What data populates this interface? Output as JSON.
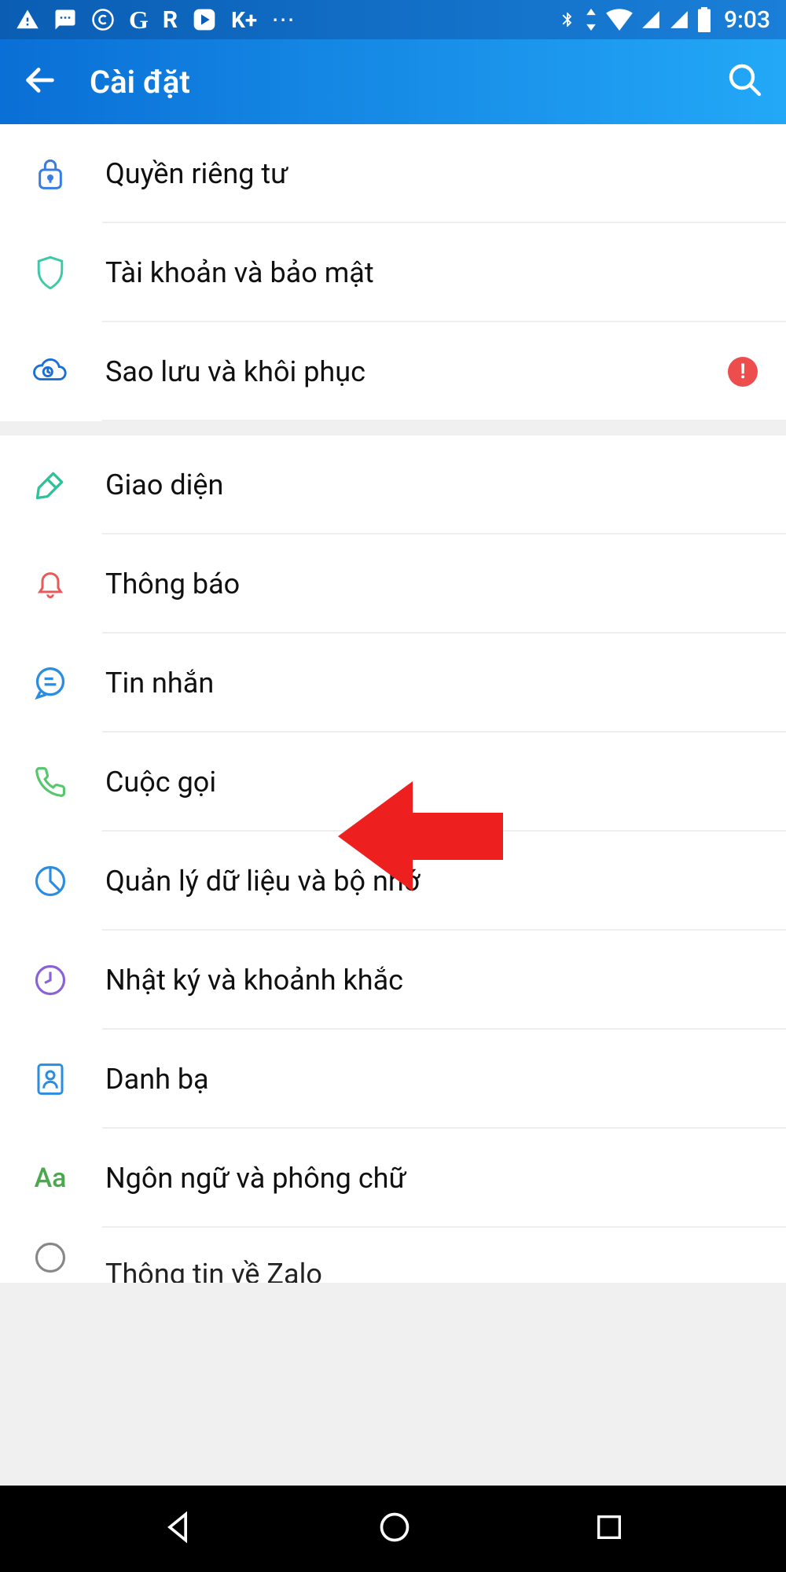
{
  "status": {
    "time": "9:03",
    "apps": [
      "⚠",
      "chat",
      "©",
      "G",
      "R",
      "▶",
      "K+",
      "⋯"
    ],
    "indicators": [
      "bluetooth",
      "wifi",
      "signal",
      "signal",
      "battery"
    ]
  },
  "header": {
    "title": "Cài đặt"
  },
  "sections": [
    {
      "items": [
        {
          "icon": "lock",
          "label": "Quyền riêng tư",
          "alert": false
        },
        {
          "icon": "shield",
          "label": "Tài khoản và bảo mật",
          "alert": false
        },
        {
          "icon": "cloud-backup",
          "label": "Sao lưu và khôi phục",
          "alert": true
        }
      ]
    },
    {
      "items": [
        {
          "icon": "brush",
          "label": "Giao diện",
          "alert": false
        },
        {
          "icon": "bell",
          "label": "Thông báo",
          "alert": false
        },
        {
          "icon": "message",
          "label": "Tin nhắn",
          "alert": false
        },
        {
          "icon": "phone",
          "label": "Cuộc gọi",
          "alert": false
        },
        {
          "icon": "chart",
          "label": "Quản lý dữ liệu và bộ nhớ",
          "alert": false
        },
        {
          "icon": "clock",
          "label": "Nhật ký và khoảnh khắc",
          "alert": false
        },
        {
          "icon": "contact",
          "label": "Danh bạ",
          "alert": false
        },
        {
          "icon": "font",
          "label": "Ngôn ngữ và phông chữ",
          "alert": false
        }
      ]
    }
  ],
  "partial_item": {
    "label": "Thông tin về Zalo"
  },
  "annotation": {
    "target_index": 2
  }
}
